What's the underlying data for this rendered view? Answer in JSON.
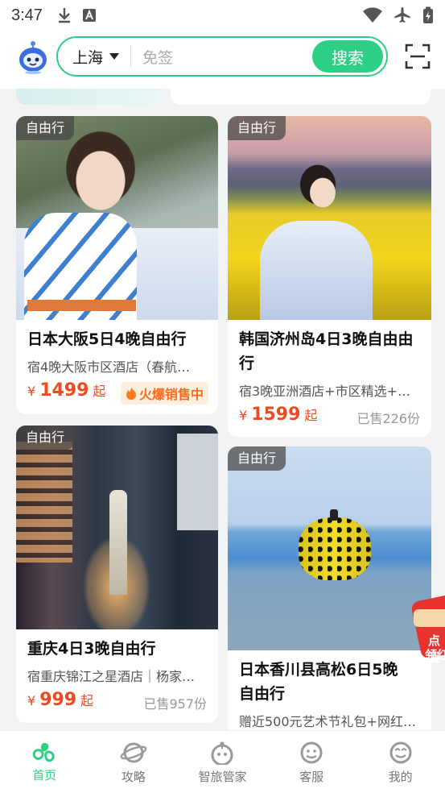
{
  "status_bar": {
    "time": "3:47"
  },
  "header": {
    "city": "上海",
    "search_placeholder": "免签",
    "search_button": "搜索"
  },
  "cards": [
    {
      "tag": "自由行",
      "title": "日本大阪5日4晚自由行",
      "subtitle": "宿4晚大阪市区酒店（春航…",
      "currency": "¥",
      "price": "1499",
      "price_suffix": "起",
      "badge": "火爆销售中"
    },
    {
      "tag": "自由行",
      "title_line1": "韩国济州岛4日3晚自由由",
      "title_line2": "行",
      "subtitle": "宿3晚亚洲酒店+市区精选+…",
      "currency": "¥",
      "price": "1599",
      "price_suffix": "起",
      "sold": "已售226份"
    },
    {
      "tag": "自由行",
      "title": "重庆4日3晚自由行",
      "subtitle": "宿重庆锦江之星酒店｜杨家…",
      "currency": "¥",
      "price": "999",
      "price_suffix": "起",
      "sold": "已售957份"
    },
    {
      "tag": "自由行",
      "title_line1": "日本香川县高松6日5晚",
      "title_line2": "自由行",
      "subtitle": "赠近500元艺术节礼包+网红…"
    }
  ],
  "promo": {
    "text_line1": "点我",
    "text_line2": "领红"
  },
  "tabs": [
    {
      "label": "首页",
      "active": true
    },
    {
      "label": "攻略",
      "active": false
    },
    {
      "label": "智旅管家",
      "active": false
    },
    {
      "label": "客服",
      "active": false
    },
    {
      "label": "我的",
      "active": false
    }
  ],
  "colors": {
    "accent": "#2dcf85",
    "price": "#f04a23"
  }
}
